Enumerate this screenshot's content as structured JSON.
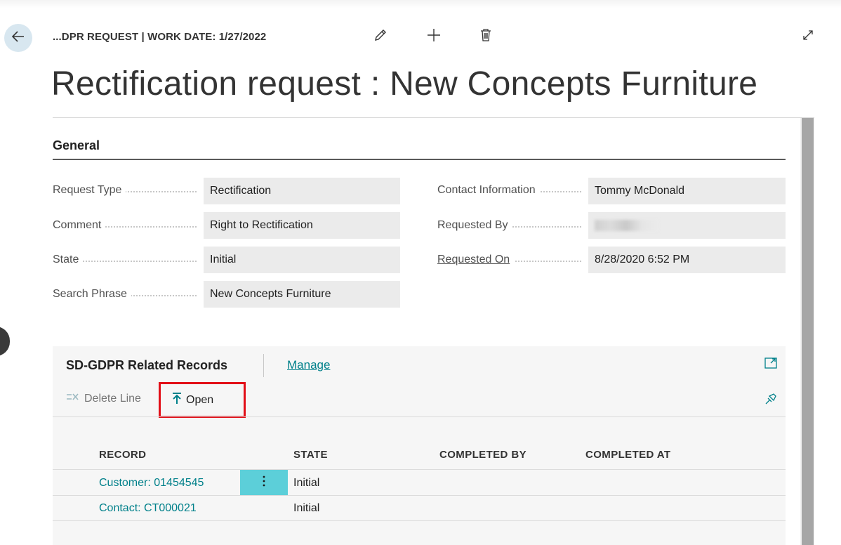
{
  "header": {
    "breadcrumb": "...DPR REQUEST | WORK DATE: 1/27/2022",
    "title": "Rectification request : New Concepts Furniture",
    "icons": [
      "back-arrow-icon",
      "pencil-icon",
      "plus-icon",
      "trash-icon",
      "expand-icon"
    ]
  },
  "general": {
    "section_title": "General",
    "fields_left": [
      {
        "label": "Request Type",
        "value": "Rectification"
      },
      {
        "label": "Comment",
        "value": "Right to Rectification"
      },
      {
        "label": "State",
        "value": "Initial"
      },
      {
        "label": "Search Phrase",
        "value": "New Concepts Furniture"
      }
    ],
    "fields_right": [
      {
        "label": "Contact Information",
        "value": "Tommy McDonald"
      },
      {
        "label": "Requested By",
        "value": ""
      },
      {
        "label": "Requested On",
        "value": "8/28/2020 6:52 PM"
      }
    ]
  },
  "related": {
    "title": "SD-GDPR Related Records",
    "manage_label": "Manage",
    "actions": {
      "delete_line": "Delete Line",
      "open": "Open"
    },
    "columns": [
      "RECORD",
      "STATE",
      "COMPLETED BY",
      "COMPLETED AT"
    ],
    "rows": [
      {
        "record": "Customer: 01454545",
        "state": "Initial",
        "completed_by": "",
        "completed_at": ""
      },
      {
        "record": "Contact: CT000021",
        "state": "Initial",
        "completed_by": "",
        "completed_at": ""
      }
    ]
  },
  "colors": {
    "accent": "#00808a",
    "highlight": "#e20e17",
    "selected_row_menu": "#5ccfd9"
  }
}
